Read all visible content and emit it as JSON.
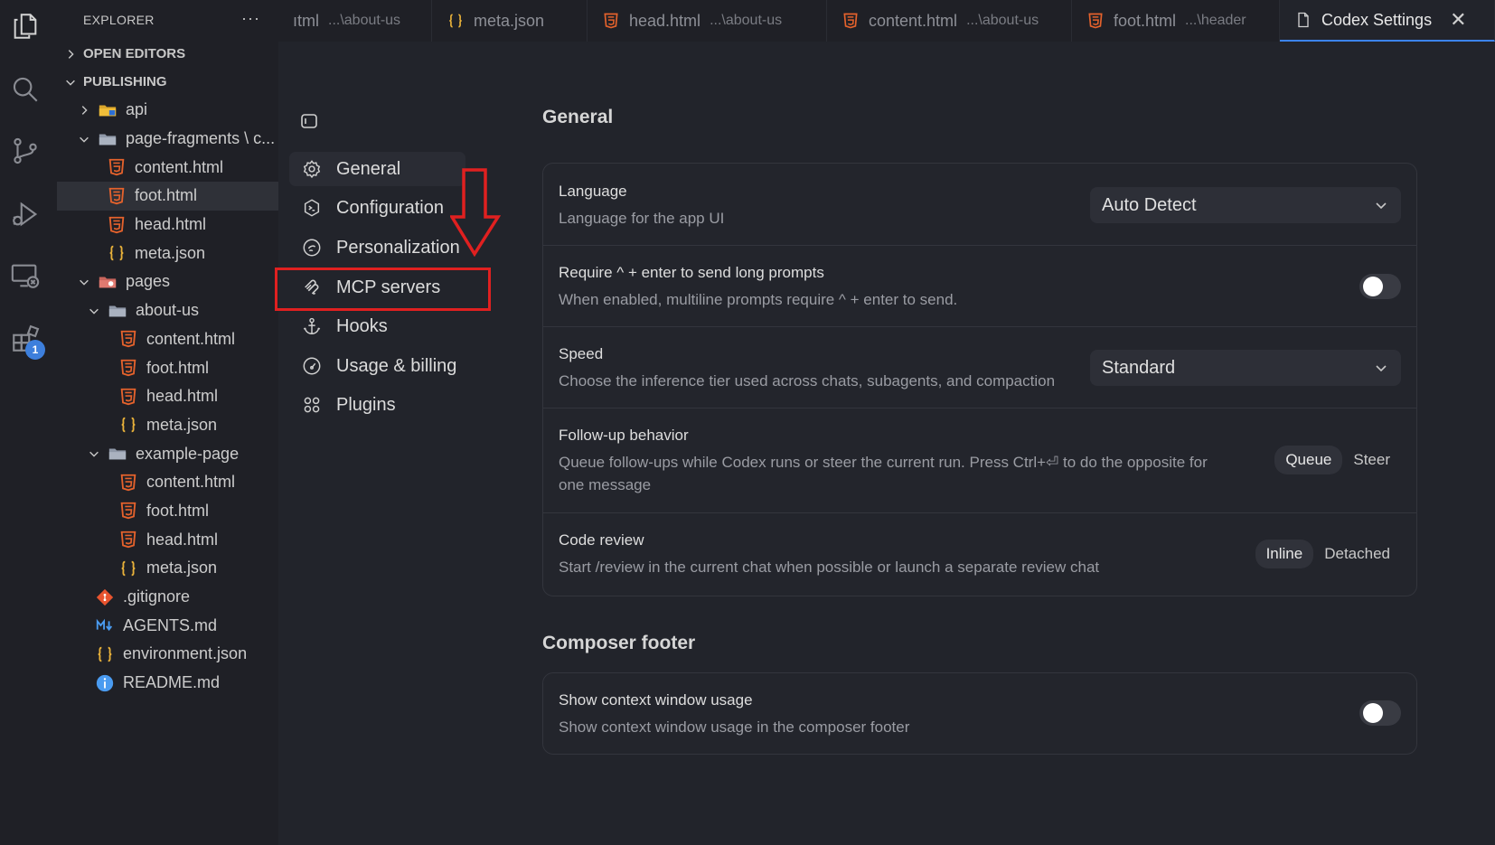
{
  "explorer": {
    "title": "EXPLORER",
    "more": "···",
    "open_editors": "OPEN EDITORS",
    "workspace": "PUBLISHING",
    "tree": [
      {
        "label": "api",
        "icon": "api-folder-icon",
        "indent": 0,
        "chevron": "right"
      },
      {
        "label": "page-fragments \\ c...",
        "icon": "folder-icon",
        "indent": 0,
        "chevron": "down"
      },
      {
        "label": "content.html",
        "icon": "html-icon",
        "indent": 1
      },
      {
        "label": "foot.html",
        "icon": "html-icon",
        "indent": 1,
        "selected": true
      },
      {
        "label": "head.html",
        "icon": "html-icon",
        "indent": 1
      },
      {
        "label": "meta.json",
        "icon": "json-icon",
        "indent": 1
      },
      {
        "label": "pages",
        "icon": "pages-folder-icon",
        "indent": 0,
        "chevron": "down"
      },
      {
        "label": "about-us",
        "icon": "folder-icon",
        "indent": 1,
        "chevron": "down"
      },
      {
        "label": "content.html",
        "icon": "html-icon",
        "indent": 2
      },
      {
        "label": "foot.html",
        "icon": "html-icon",
        "indent": 2
      },
      {
        "label": "head.html",
        "icon": "html-icon",
        "indent": 2
      },
      {
        "label": "meta.json",
        "icon": "json-icon",
        "indent": 2
      },
      {
        "label": "example-page",
        "icon": "folder-icon",
        "indent": 1,
        "chevron": "down"
      },
      {
        "label": "content.html",
        "icon": "html-icon",
        "indent": 2
      },
      {
        "label": "foot.html",
        "icon": "html-icon",
        "indent": 2
      },
      {
        "label": "head.html",
        "icon": "html-icon",
        "indent": 2
      },
      {
        "label": "meta.json",
        "icon": "json-icon",
        "indent": 2
      },
      {
        "label": ".gitignore",
        "icon": "git-icon",
        "indent": 0
      },
      {
        "label": "AGENTS.md",
        "icon": "markdown-icon",
        "indent": 0
      },
      {
        "label": "environment.json",
        "icon": "json-icon",
        "indent": 0
      },
      {
        "label": "README.md",
        "icon": "info-icon",
        "indent": 0
      }
    ]
  },
  "activity": {
    "extensions_badge": "1"
  },
  "tabs": [
    {
      "label": "ıtml",
      "sub": "...\\about-us",
      "icon": ""
    },
    {
      "label": "meta.json",
      "sub": "",
      "icon": "json-icon"
    },
    {
      "label": "head.html",
      "sub": "...\\about-us",
      "icon": "html-icon"
    },
    {
      "label": "content.html",
      "sub": "...\\about-us",
      "icon": "html-icon"
    },
    {
      "label": "foot.html",
      "sub": "...\\header",
      "icon": "html-icon"
    },
    {
      "label": "Codex Settings",
      "sub": "",
      "icon": "file-icon",
      "active": true,
      "close": "✕"
    }
  ],
  "nav": {
    "items": [
      {
        "label": "General",
        "icon": "gear-icon",
        "active": true
      },
      {
        "label": "Configuration",
        "icon": "terminal-icon"
      },
      {
        "label": "Personalization",
        "icon": "personalization-icon"
      },
      {
        "label": "MCP servers",
        "icon": "mcp-icon"
      },
      {
        "label": "Hooks",
        "icon": "anchor-icon"
      },
      {
        "label": "Usage & billing",
        "icon": "gauge-icon"
      },
      {
        "label": "Plugins",
        "icon": "plugins-icon"
      }
    ]
  },
  "general": {
    "title": "General",
    "language": {
      "title": "Language",
      "desc": "Language for the app UI",
      "value": "Auto Detect"
    },
    "require": {
      "title": "Require ^ + enter to send long prompts",
      "desc": "When enabled, multiline prompts require ^ + enter to send.",
      "enabled": false
    },
    "speed": {
      "title": "Speed",
      "desc": "Choose the inference tier used across chats, subagents, and compaction",
      "value": "Standard"
    },
    "followup": {
      "title": "Follow-up behavior",
      "desc_line1": "Queue follow-ups while Codex runs or steer the current run. Press Ctrl+⏎ to do the opposite for",
      "desc_line2": "one message",
      "option_a": "Queue",
      "option_b": "Steer",
      "selected": "Queue"
    },
    "review": {
      "title": "Code review",
      "desc": "Start /review in the current chat when possible or launch a separate review chat",
      "option_a": "Inline",
      "option_b": "Detached",
      "selected": "Inline"
    }
  },
  "composer": {
    "title": "Composer footer",
    "context": {
      "title": "Show context window usage",
      "desc": "Show context window usage in the composer footer",
      "enabled": false
    }
  },
  "colors": {
    "accent": "#3c84f0",
    "highlight": "#e02020",
    "html_icon": "#e5622c",
    "json_icon": "#e8b13a",
    "folder": "#9aa3b5"
  }
}
